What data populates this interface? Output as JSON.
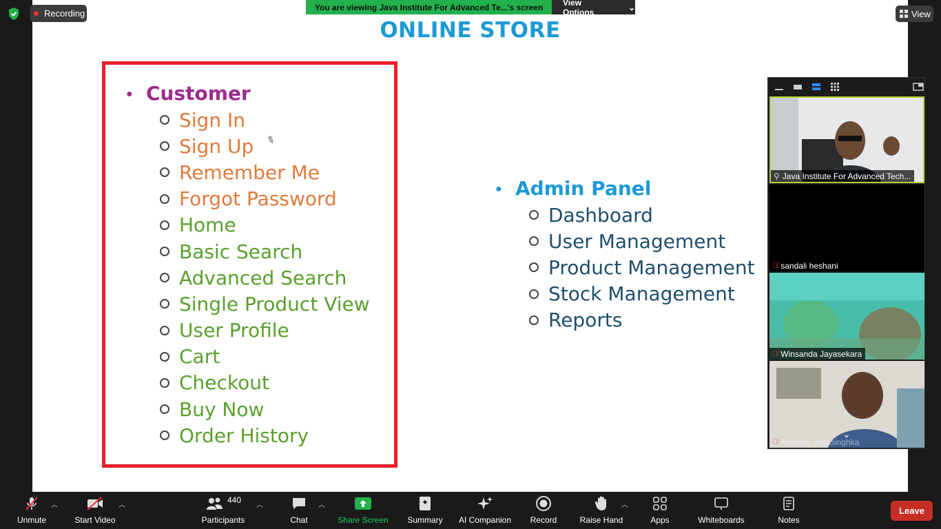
{
  "top": {
    "recording_label": "Recording",
    "share_banner": "You are viewing Java Institute For Advanced Te...'s screen",
    "view_options": "View Options",
    "view_label": "View"
  },
  "slide": {
    "title": "ONLINE STORE",
    "customer_heading": "Customer",
    "customer_items": [
      {
        "label": "Sign In",
        "color": "#e07a3a"
      },
      {
        "label": "Sign Up",
        "color": "#e07a3a"
      },
      {
        "label": "Remember Me",
        "color": "#e07a3a"
      },
      {
        "label": "Forgot Password",
        "color": "#e07a3a"
      },
      {
        "label": "Home",
        "color": "#5aa02c"
      },
      {
        "label": "Basic Search",
        "color": "#5aa02c"
      },
      {
        "label": "Advanced Search",
        "color": "#5aa02c"
      },
      {
        "label": "Single Product View",
        "color": "#5aa02c"
      },
      {
        "label": "User Profile",
        "color": "#5aa02c"
      },
      {
        "label": "Cart",
        "color": "#5aa02c"
      },
      {
        "label": "Checkout",
        "color": "#5aa02c"
      },
      {
        "label": "Buy Now",
        "color": "#5aa02c"
      },
      {
        "label": "Order History",
        "color": "#5aa02c"
      }
    ],
    "admin_heading": "Admin Panel",
    "admin_items": [
      "Dashboard",
      "User Management",
      "Product Management",
      "Stock Management",
      "Reports"
    ]
  },
  "participants_panel": {
    "tiles": [
      {
        "name": "Java Institute For Advanced Tech..."
      },
      {
        "name": "sandali heshani"
      },
      {
        "name": "Winsanda Jayasekara"
      },
      {
        "name": "Navindu Jayasinghka"
      }
    ]
  },
  "toolbar": {
    "unmute": "Unmute",
    "start_video": "Start Video",
    "participants": "Participants",
    "participant_count": "440",
    "chat": "Chat",
    "share_screen": "Share Screen",
    "summary": "Summary",
    "ai_companion": "AI Companion",
    "record": "Record",
    "raise_hand": "Raise Hand",
    "apps": "Apps",
    "whiteboards": "Whiteboards",
    "notes": "Notes",
    "leave": "Leave"
  },
  "colors": {
    "title": "#1d9ad6",
    "customer_heading": "#9b2c8e",
    "admin_heading": "#1d9ad6",
    "admin_items": "#1f4e6b",
    "box_border": "#e8202a",
    "share_green": "#22b14c",
    "leave_red": "#c62e24"
  }
}
